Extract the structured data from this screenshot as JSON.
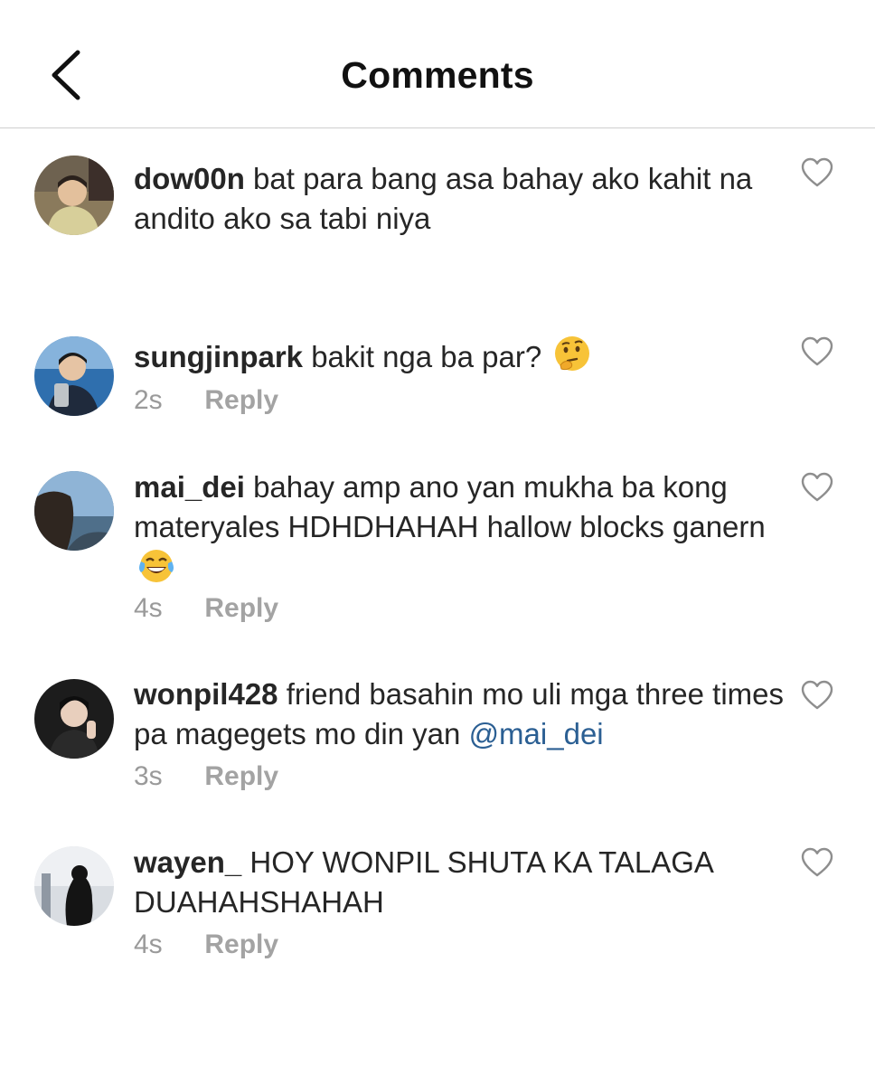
{
  "header": {
    "title": "Comments",
    "back_icon": "chevron-left-icon"
  },
  "comments": [
    {
      "username": "dow00n",
      "text": "bat para bang asa bahay ako kahit na andito ako sa tabi niya",
      "time": "",
      "reply": ""
    },
    {
      "username": "sungjinpark",
      "text": "bakit nga ba par?",
      "emoji": "thinking-face-emoji",
      "time": "2s",
      "reply": "Reply"
    },
    {
      "username": "mai_dei",
      "text": "bahay amp ano yan mukha ba kong materyales HDHDHAHAH hallow blocks ganern",
      "emoji": "tears-of-joy-emoji",
      "time": "4s",
      "reply": "Reply"
    },
    {
      "username": "wonpil428",
      "text": "friend basahin mo uli mga three times pa magegets mo din yan",
      "mention": "@mai_dei",
      "time": "3s",
      "reply": "Reply"
    },
    {
      "username": "wayen_",
      "text": "HOY WONPIL SHUTA KA TALAGA DUAHAHSHAHAH",
      "time": "4s",
      "reply": "Reply"
    }
  ],
  "colors": {
    "text": "#262626",
    "meta": "#9a9a9a",
    "mention": "#2b5f93",
    "divider": "#cfcfcf"
  }
}
